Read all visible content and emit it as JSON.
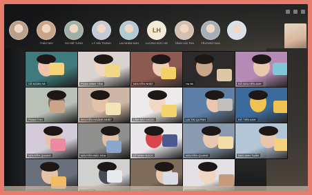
{
  "scene": {
    "description_colors": {
      "frame": "#e67d6c",
      "screen": "#17191c"
    }
  },
  "participants_top": [
    {
      "name": "",
      "initials": "",
      "color": "#b9a08a"
    },
    {
      "name": "THẢO NHI",
      "initials": "",
      "color": "#c7a58a"
    },
    {
      "name": "HO HIỆ TUNG",
      "initials": "",
      "color": "#9fb1a6"
    },
    {
      "name": "LÝ HẢI THANH",
      "initials": "",
      "color": "#c4cbd6"
    },
    {
      "name": "LAI NHẬN NAH",
      "initials": "",
      "color": "#b0c9d4"
    },
    {
      "name": "LƯƠNG ĐỨC HĐ",
      "initials": "LH",
      "color": "#f2ead7"
    },
    {
      "name": "TÂNG HẢI THA",
      "initials": "",
      "color": "#d3bfb0"
    },
    {
      "name": "TRƯƠNG DAA",
      "initials": "",
      "color": "#a7aeb6"
    },
    {
      "name": "",
      "initials": "",
      "color": "#d8e1ea"
    }
  ],
  "icons": [
    "mic-icon",
    "video-icon",
    "more-icon"
  ],
  "tiles": [
    {
      "label": "VŨ NGÂN HÀ",
      "bg": "#3f7a7c",
      "blob": "#efc3a8",
      "card": "#f4d37a"
    },
    {
      "label": "PHAN MINH TÂM",
      "bg": "#d9d2cf",
      "blob": "#f1d6c5",
      "card": "#f0d886"
    },
    {
      "label": "NGUYỄN NHẬT",
      "bg": "#8d5a52",
      "blob": "#eccfb6",
      "card": "#f5cf6a"
    },
    {
      "label": "Ha Nh",
      "bg": "#2d2a2b",
      "blob": "#c9a687",
      "card": "#ddc7a5"
    },
    {
      "label": "ĐỖ NGUYÊN ANH",
      "bg": "#b58bb5",
      "blob": "#e9c7ad",
      "card": "#7fc6d6"
    },
    {
      "label": "PHẠM THU",
      "bg": "#b9c0b8",
      "blob": "#7d6b5e",
      "card": "#caa587"
    },
    {
      "label": "NGUYỄN HOÀNG NHẬT",
      "bg": "#cdb6a6",
      "blob": "#e3c2a7",
      "card": "#f3e4b8"
    },
    {
      "label": "LÂM BẢO NGỌC",
      "bg": "#eceaea",
      "blob": "#f2d7c6",
      "card": "#f4d46a"
    },
    {
      "label": "LẠI THỊ QUỲNH",
      "bg": "#5d7fa6",
      "blob": "#e9c7b0",
      "card": "#c0bfbd"
    },
    {
      "label": "ĐỖ TIẾN ANH",
      "bg": "#3b6b9a",
      "blob": "#f0c24f",
      "card": "#f0c24f"
    },
    {
      "label": "NGUYỄN QUANG",
      "bg": "#d3ccd8",
      "blob": "#e7c2ac",
      "card": "#ee8aa0"
    },
    {
      "label": "NGUYỄN BẢO NGA",
      "bg": "#8f8f8e",
      "blob": "#e1c0a8",
      "card": "#8aa6c9"
    },
    {
      "label": "LÊ MINH NGỌC",
      "bg": "#e9e6ea",
      "blob": "#d9464e",
      "card": "#4a5a8f"
    },
    {
      "label": "NGUYỄN QUANG",
      "bg": "#8a9bb1",
      "blob": "#e9c8b2",
      "card": "#f3dfa5"
    },
    {
      "label": "ĐÀO ANH TUẤN",
      "bg": "#b3c6d8",
      "blob": "#e8c5ae",
      "card": "#f7d07c"
    },
    {
      "label": "TRẦN THẢO",
      "bg": "#6a6f7c",
      "blob": "#e4c3a9",
      "card": "#f0bb62"
    },
    {
      "label": "HẢI NGỌC",
      "bg": "#d0d1cf",
      "blob": "#494c55",
      "card": "#e7e9ee"
    },
    {
      "label": "HOÀNG AN",
      "bg": "#7f6b5a",
      "blob": "#e6c8b1",
      "card": "#d9dce4"
    },
    {
      "label": "LƯƠNG TÚ VY",
      "bg": "#e4e1e4",
      "blob": "#f0d5c3",
      "card": "#c79a7a"
    }
  ]
}
